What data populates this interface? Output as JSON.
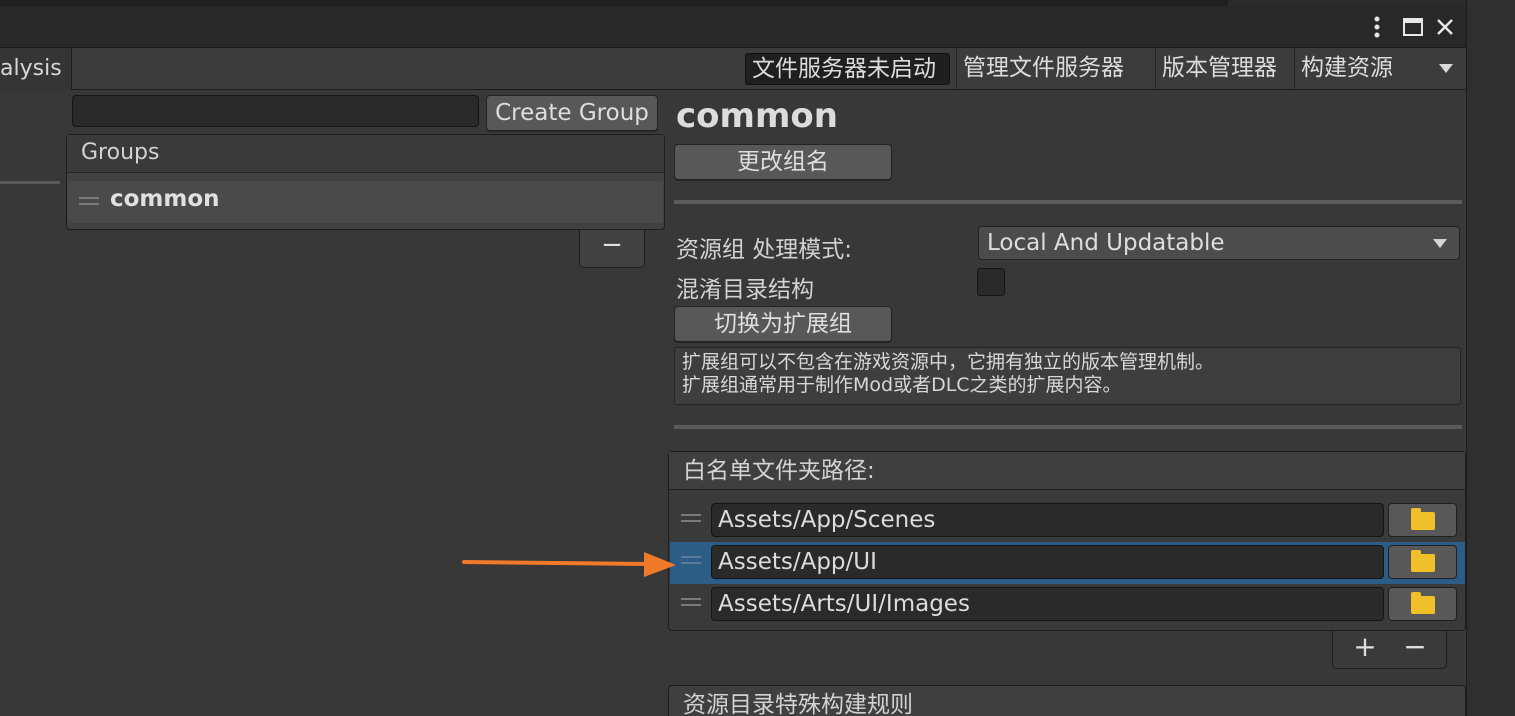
{
  "toolbar": {
    "tab_analysis": "alysis",
    "server_status": "文件服务器未启动",
    "manage_server": "管理文件服务器",
    "version_manager": "版本管理器",
    "build_assets": "构建资源"
  },
  "groups": {
    "create_group_label": "Create Group",
    "header": "Groups",
    "items": [
      {
        "label": "common"
      }
    ],
    "minus_label": "−"
  },
  "detail": {
    "title": "common",
    "rename_button": "更改组名",
    "mode_label": "资源组 处理模式:",
    "mode_value": "Local And Updatable",
    "obfuscate_label": "混淆目录结构",
    "switch_button": "切换为扩展组",
    "help_lines": [
      "扩展组可以不包含在游戏资源中，它拥有独立的版本管理机制。",
      "扩展组通常用于制作Mod或者DLC之类的扩展内容。"
    ]
  },
  "whitelist": {
    "header": "白名单文件夹路径:",
    "paths": [
      "Assets/App/Scenes",
      "Assets/App/UI",
      "Assets/Arts/UI/Images"
    ],
    "selected_index": 1,
    "add_label": "+",
    "remove_label": "−"
  },
  "rules": {
    "header": "资源目录特殊构建规则"
  },
  "colors": {
    "selection": "#2c5d87",
    "folder": "#f0c02a",
    "annotation_arrow": "#f07a2a"
  }
}
